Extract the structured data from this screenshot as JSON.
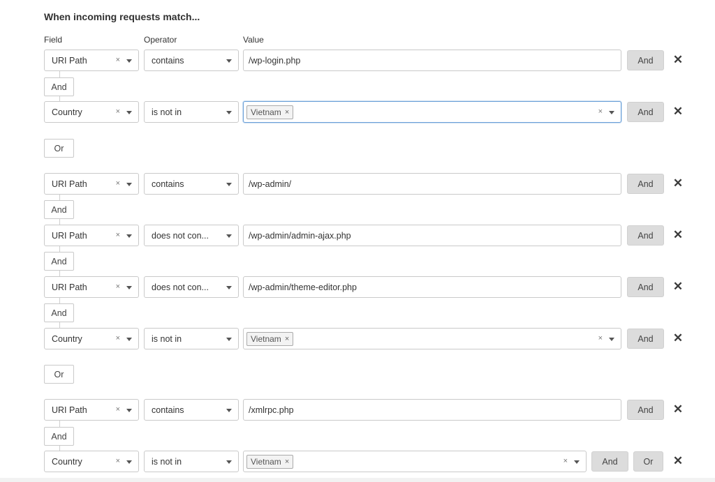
{
  "heading": "When incoming requests match...",
  "columns": {
    "field": "Field",
    "operator": "Operator",
    "value": "Value"
  },
  "clear_glyph": "×",
  "delete_glyph": "✕",
  "rows": [
    {
      "field": "URI Path",
      "operator": "contains",
      "value": "/wp-login.php",
      "buttons": [
        "And"
      ]
    },
    {
      "field": "Country",
      "operator": "is not in",
      "tag": "Vietnam",
      "buttons": [
        "And"
      ]
    },
    {
      "field": "URI Path",
      "operator": "contains",
      "value": "/wp-admin/",
      "buttons": [
        "And"
      ]
    },
    {
      "field": "URI Path",
      "operator": "does not con...",
      "value": "/wp-admin/admin-ajax.php",
      "buttons": [
        "And"
      ]
    },
    {
      "field": "URI Path",
      "operator": "does not con...",
      "value": "/wp-admin/theme-editor.php",
      "buttons": [
        "And"
      ]
    },
    {
      "field": "Country",
      "operator": "is not in",
      "tag": "Vietnam",
      "buttons": [
        "And"
      ]
    },
    {
      "field": "URI Path",
      "operator": "contains",
      "value": "/xmlrpc.php",
      "buttons": [
        "And"
      ]
    },
    {
      "field": "Country",
      "operator": "is not in",
      "tag": "Vietnam",
      "buttons": [
        "And",
        "Or"
      ]
    }
  ],
  "connectors": [
    "And",
    "Or",
    "And",
    "And",
    "And",
    "Or",
    "And"
  ]
}
